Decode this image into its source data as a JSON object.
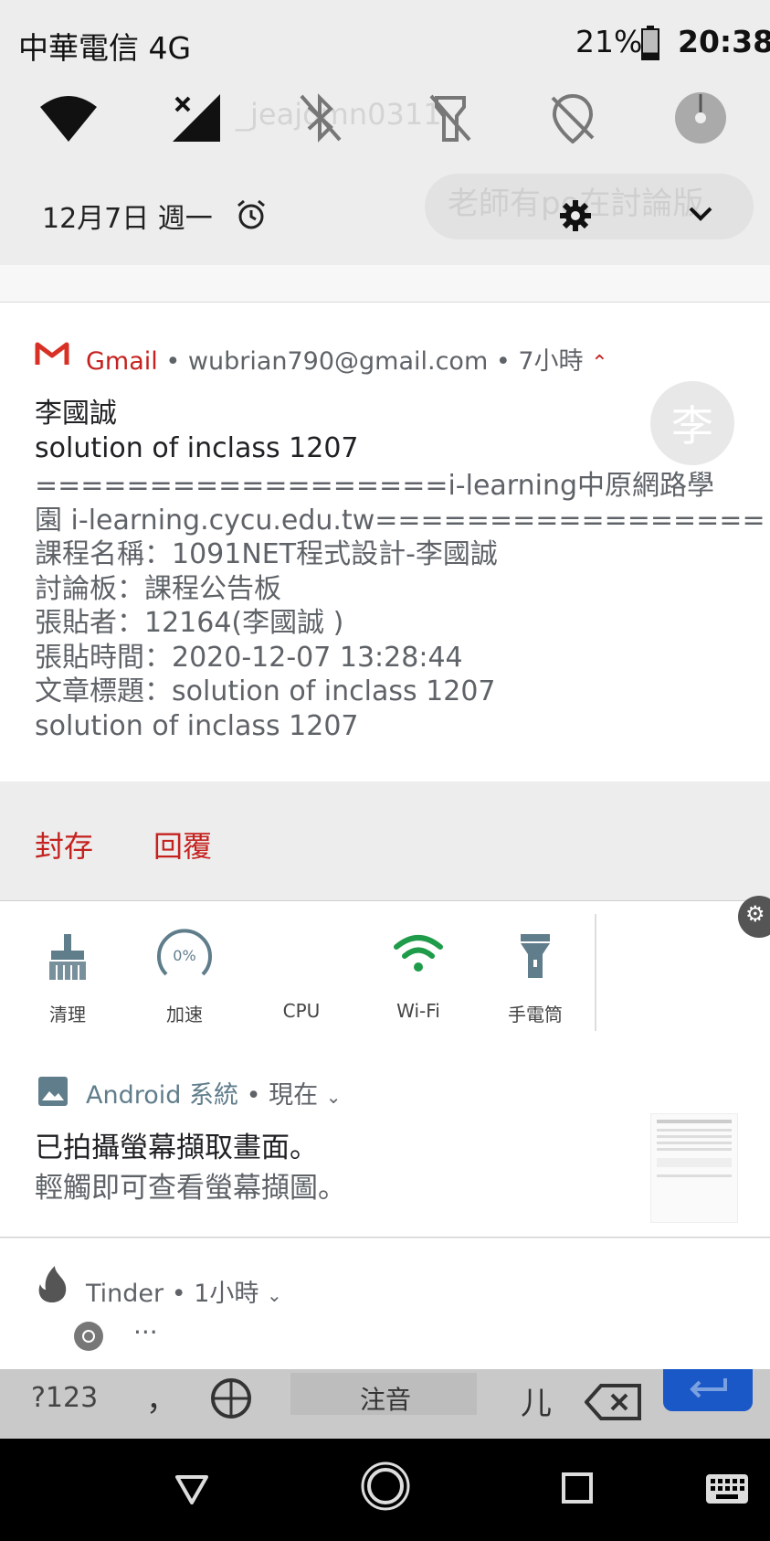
{
  "status_bar": {
    "carrier": "中華電信 4G",
    "battery_percent": "21%",
    "battery_level": 0.21,
    "time": "20:38"
  },
  "quick_settings": {
    "tiles": [
      {
        "name": "wifi",
        "icon": "wifi-icon"
      },
      {
        "name": "mobile-data",
        "icon": "signal-off-icon"
      },
      {
        "name": "bluetooth",
        "icon": "bluetooth-off-icon"
      },
      {
        "name": "flashlight",
        "icon": "flashlight-off-icon"
      },
      {
        "name": "location",
        "icon": "location-off-icon"
      },
      {
        "name": "auto-rotate",
        "icon": "disc-icon"
      }
    ],
    "ghost_username": "_jeajomn0311",
    "ghost_notification_text": "老師有po在討論版",
    "date": "12月7日 週一"
  },
  "gmail_notification": {
    "app_name": "Gmail",
    "account": "wubrian790@gmail.com",
    "time_ago": "7小時",
    "sender": "李國誠",
    "avatar_letter": "李",
    "subject": "solution of inclass 1207",
    "body_lines": [
      "==================i-learning中原網路學",
      "園 i-learning.cycu.edu.tw=================",
      "課程名稱：1091NET程式設計-李國誠",
      "討論板：課程公告板",
      "張貼者：12164(李國誠 )",
      "張貼時間：2020-12-07 13:28:44",
      "文章標題：solution of inclass 1207",
      "solution of inclass 1207"
    ],
    "actions": {
      "archive": "封存",
      "reply": "回覆"
    }
  },
  "cleaner_widget": {
    "items": [
      {
        "label": "清理",
        "icon": "broom-icon"
      },
      {
        "label": "加速",
        "icon": "speed-gauge-icon",
        "value": "0%"
      },
      {
        "label": "CPU",
        "icon": "cpu-icon"
      },
      {
        "label": "Wi-Fi",
        "icon": "wifi-icon"
      },
      {
        "label": "手電筒",
        "icon": "flashlight-icon"
      }
    ],
    "wifi_color": "#1e9c4a"
  },
  "android_notification": {
    "app_name": "Android 系統",
    "time_ago": "現在",
    "title": "已拍攝螢幕擷取畫面。",
    "text": "輕觸即可查看螢幕擷圖。"
  },
  "tinder_notification": {
    "app_name": "Tinder",
    "time_ago": "1小時",
    "more": "···"
  },
  "keyboard_ghost": {
    "keys": [
      "?123",
      "，",
      "注音",
      "儿"
    ]
  },
  "colors": {
    "gmail_red": "#c5221f",
    "android_teal": "#607d8b",
    "widget_wifi": "#1e9c4a"
  }
}
